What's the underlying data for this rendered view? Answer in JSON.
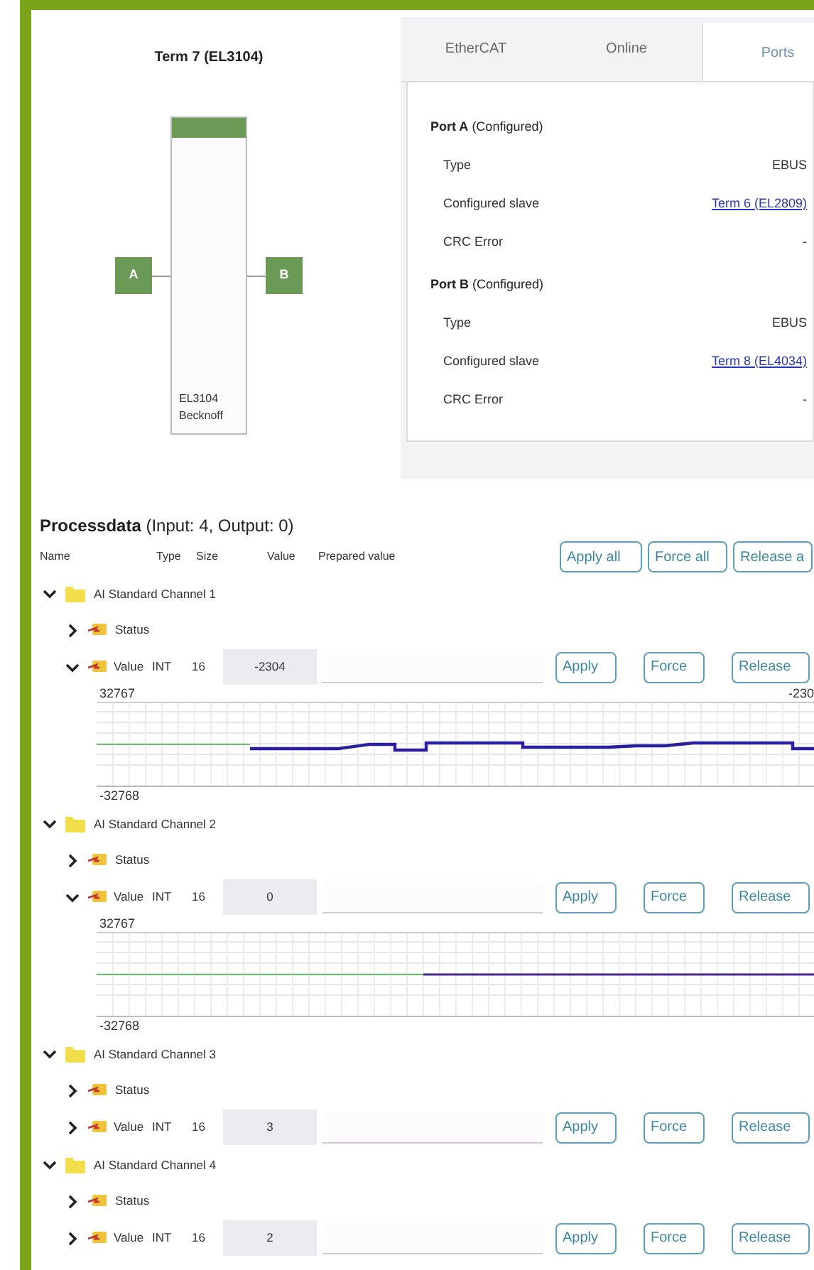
{
  "terminal": {
    "title": "Term 7 (EL3104)",
    "ports": [
      "A",
      "B"
    ],
    "module_lines": [
      "EL3104",
      "Becknoff"
    ]
  },
  "tabs": [
    {
      "label": "EtherCAT",
      "selected": false
    },
    {
      "label": "Online",
      "selected": false
    },
    {
      "label": "Ports",
      "selected": true
    }
  ],
  "ports": [
    {
      "name": "Port A",
      "state": "(Configured)",
      "rows": [
        {
          "label": "Type",
          "value": "EBUS",
          "kind": "text"
        },
        {
          "label": "Configured slave",
          "value": "Term 6 (EL2809)",
          "kind": "link"
        },
        {
          "label": "CRC Error",
          "value": "-",
          "kind": "text"
        }
      ]
    },
    {
      "name": "Port B",
      "state": "(Configured)",
      "rows": [
        {
          "label": "Type",
          "value": "EBUS",
          "kind": "text"
        },
        {
          "label": "Configured slave",
          "value": "Term 8 (EL4034)",
          "kind": "link"
        },
        {
          "label": "CRC Error",
          "value": "-",
          "kind": "text"
        }
      ]
    }
  ],
  "processdata": {
    "title": "Processdata",
    "summary": "(Input: 4, Output: 0)",
    "columns": [
      "Name",
      "Type",
      "Size",
      "Value",
      "Prepared value"
    ],
    "actions": [
      "Apply all",
      "Force all",
      "Release a"
    ],
    "channels": [
      {
        "name": "AI Standard Channel 1",
        "expanded": true,
        "items": [
          {
            "kind": "group",
            "name": "Status",
            "expanded": false
          },
          {
            "kind": "variable",
            "name": "Value",
            "type": "INT",
            "size": "16",
            "value": "-2304",
            "expanded": true,
            "actions": [
              "Apply",
              "Force",
              "Release"
            ],
            "trend": {
              "kind": "varying",
              "max": "32767",
              "min": "-32768",
              "reading": "-230"
            }
          }
        ]
      },
      {
        "name": "AI Standard Channel 2",
        "expanded": true,
        "items": [
          {
            "kind": "group",
            "name": "Status",
            "expanded": false
          },
          {
            "kind": "variable",
            "name": "Value",
            "type": "INT",
            "size": "16",
            "value": "0",
            "expanded": true,
            "actions": [
              "Apply",
              "Force",
              "Release"
            ],
            "trend": {
              "kind": "steady",
              "max": "32767",
              "min": "-32768"
            }
          }
        ]
      },
      {
        "name": "AI Standard Channel 3",
        "expanded": true,
        "items": [
          {
            "kind": "group",
            "name": "Status",
            "expanded": false
          },
          {
            "kind": "variable",
            "name": "Value",
            "type": "INT",
            "size": "16",
            "value": "3",
            "expanded": false,
            "actions": [
              "Apply",
              "Force",
              "Release"
            ]
          }
        ]
      },
      {
        "name": "AI Standard Channel 4",
        "expanded": true,
        "items": [
          {
            "kind": "group",
            "name": "Status",
            "expanded": false
          },
          {
            "kind": "variable",
            "name": "Value",
            "type": "INT",
            "size": "16",
            "value": "2",
            "expanded": false,
            "actions": [
              "Apply",
              "Force",
              "Release"
            ]
          }
        ]
      }
    ]
  }
}
